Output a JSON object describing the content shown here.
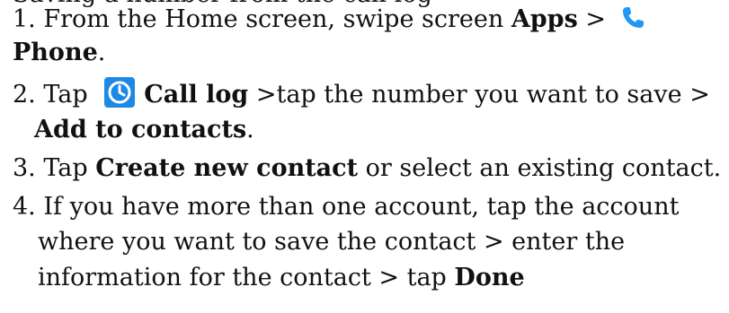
{
  "document": {
    "partial_top_line": "Saving a number from the call log",
    "step1": {
      "prefix": "1. From the Home screen, swipe screen ",
      "apps": "Apps",
      "separator": " > ",
      "phone": "Phone",
      "end": "."
    },
    "step2": {
      "prefix": "2. Tap ",
      "call_log": "Call log",
      "middle": " >tap the number you want to save >",
      "add_to_contacts": "Add to contacts",
      "end": "."
    },
    "step3": {
      "prefix": "3. Tap ",
      "create_new_contact": "Create new contact",
      "suffix": " or select an existing contact."
    },
    "step4": {
      "line1": "4. If you have more than one account, tap the account",
      "line2": "where you want to save the contact > enter the",
      "line3_prefix": "information for the contact > tap ",
      "done": "Done"
    },
    "icons": {
      "phone_icon": "phone-icon",
      "clock_icon": "clock-icon",
      "phone_color": "#2196f3",
      "clock_color": "#1e88e5"
    }
  }
}
